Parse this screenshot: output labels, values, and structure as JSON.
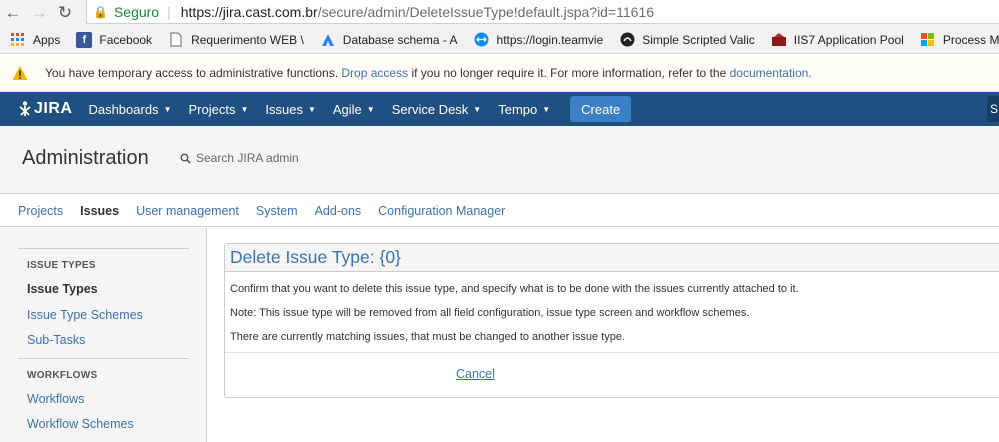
{
  "browser": {
    "secure_label": "Seguro",
    "url_domain": "https://jira.cast.com.br",
    "url_path": "/secure/admin/DeleteIssueType!default.jspa?id=11616"
  },
  "bookmarks": [
    {
      "label": "Apps",
      "icon": "apps-grid-icon"
    },
    {
      "label": "Facebook",
      "icon": "facebook-icon"
    },
    {
      "label": "Requerimento WEB \\",
      "icon": "document-icon"
    },
    {
      "label": "Database schema - A",
      "icon": "atlassian-icon"
    },
    {
      "label": "https://login.teamvie",
      "icon": "teamviewer-icon"
    },
    {
      "label": "Simple Scripted Valic",
      "icon": "scriptrunner-icon"
    },
    {
      "label": "IIS7 Application Pool",
      "icon": "iis-icon"
    },
    {
      "label": "Process Model Setti",
      "icon": "windows-icon"
    }
  ],
  "banner": {
    "text_before": "You have temporary access to administrative functions.",
    "drop_link": "Drop access",
    "text_middle": "if you no longer require it. For more information, refer to the",
    "doc_link": "documentation",
    "text_after": "."
  },
  "header": {
    "logo": "JIRA",
    "nav": [
      "Dashboards",
      "Projects",
      "Issues",
      "Agile",
      "Service Desk",
      "Tempo"
    ],
    "create_label": "Create",
    "search_stub": "S"
  },
  "admin": {
    "title": "Administration",
    "search_placeholder": "Search JIRA admin",
    "tabs": [
      "Projects",
      "Issues",
      "User management",
      "System",
      "Add-ons",
      "Configuration Manager"
    ]
  },
  "sidebar": {
    "section1_heading": "ISSUE TYPES",
    "section1_items": [
      "Issue Types",
      "Issue Type Schemes",
      "Sub-Tasks"
    ],
    "section2_heading": "WORKFLOWS",
    "section2_items": [
      "Workflows",
      "Workflow Schemes"
    ]
  },
  "panel": {
    "title": "Delete Issue Type: {0}",
    "p1": "Confirm that you want to delete this issue type, and specify what is to be done with the issues currently attached to it.",
    "p2": "Note: This issue type will be removed from all field configuration, issue type screen and workflow schemes.",
    "p3": "There are currently matching issues, that must be changed to another issue type.",
    "cancel_label": "Cancel"
  },
  "colors": {
    "header_bg": "#205081",
    "create_bg": "#3b7fc4",
    "link": "#3b73af",
    "secure_green": "#1a8a3a",
    "warning": "#f0b400"
  }
}
